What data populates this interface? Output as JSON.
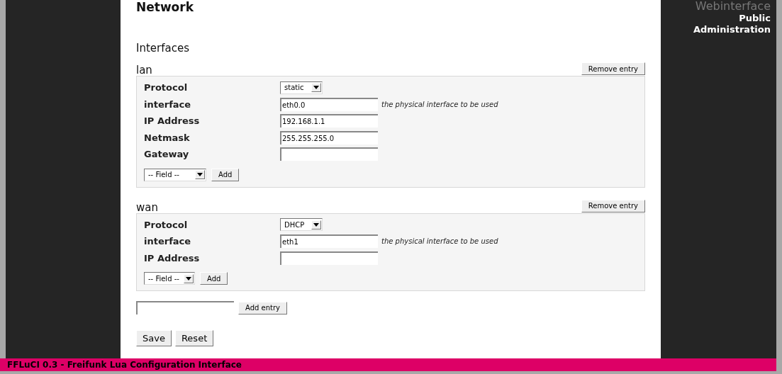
{
  "page_title": "Network",
  "menu": [
    {
      "label": "Webinterface",
      "kind": "heading"
    },
    {
      "label": "Public",
      "kind": "link"
    },
    {
      "label": "Administration",
      "kind": "link"
    }
  ],
  "section_title": "Interfaces",
  "sections": [
    {
      "name": "lan",
      "remove_button": "Remove entry",
      "fields": [
        {
          "kind": "select",
          "label": "Protocol",
          "value": "static"
        },
        {
          "kind": "text",
          "label": "interface",
          "value": "eth0.0",
          "hint": "the physical interface to be used"
        },
        {
          "kind": "text",
          "label": "IP Address",
          "value": "192.168.1.1"
        },
        {
          "kind": "text",
          "label": "Netmask",
          "value": "255.255.255.0"
        },
        {
          "kind": "text",
          "label": "Gateway"
        }
      ],
      "field_select": "-- Field --",
      "add_button": "Add"
    },
    {
      "name": "wan",
      "remove_button": "Remove entry",
      "fields": [
        {
          "kind": "select",
          "label": "Protocol",
          "value": "DHCP"
        },
        {
          "kind": "text",
          "label": "interface",
          "value": "eth1",
          "hint": "the physical interface to be used"
        },
        {
          "kind": "text",
          "label": "IP Address"
        }
      ],
      "field_select": "-- Field --",
      "add_button": "Add"
    }
  ],
  "add_entry_button": "Add entry",
  "buttons": [
    "Save",
    "Reset"
  ],
  "footer": "FFLuCI 0.3 - Freifunk Lua Configuration Interface"
}
